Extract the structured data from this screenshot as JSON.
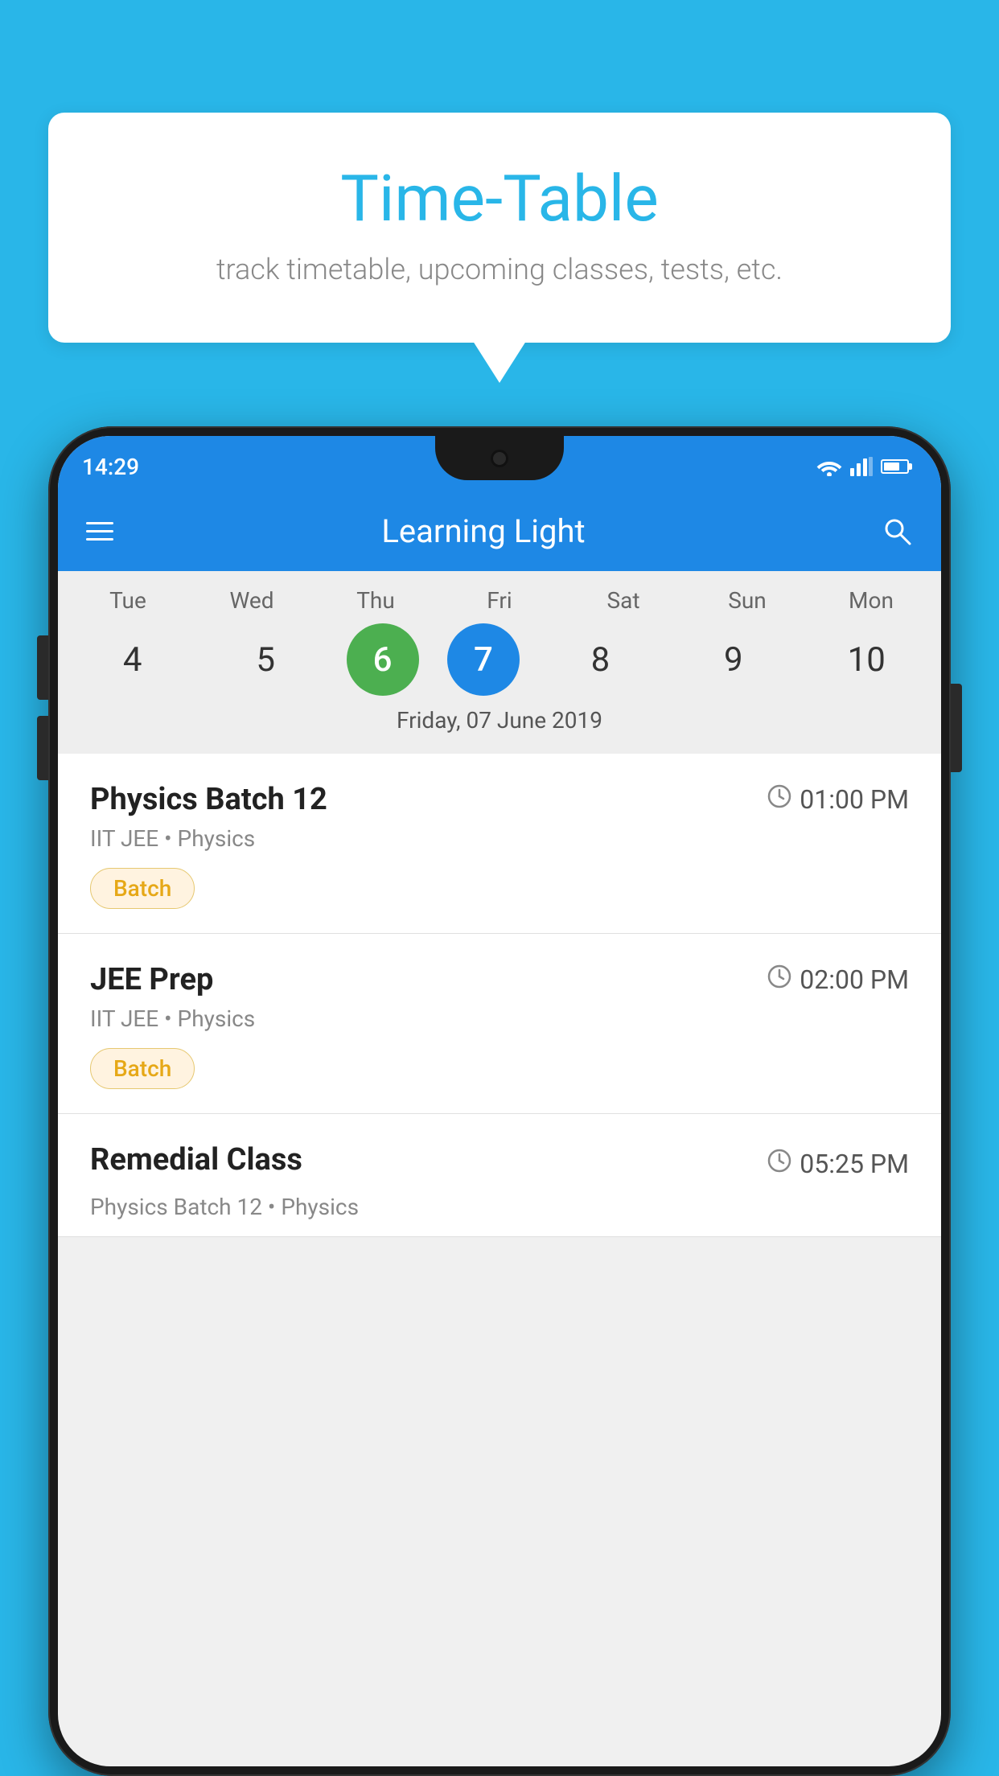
{
  "background_color": "#29B6E8",
  "speech_bubble": {
    "title": "Time-Table",
    "subtitle": "track timetable, upcoming classes, tests, etc."
  },
  "phone": {
    "status_bar": {
      "time": "14:29"
    },
    "app_bar": {
      "title": "Learning Light",
      "menu_icon": "hamburger-icon",
      "search_icon": "search-icon"
    },
    "calendar": {
      "days": [
        "Tue",
        "Wed",
        "Thu",
        "Fri",
        "Sat",
        "Sun",
        "Mon"
      ],
      "dates": [
        "4",
        "5",
        "6",
        "7",
        "8",
        "9",
        "10"
      ],
      "today_index": 2,
      "selected_index": 3,
      "selected_date_label": "Friday, 07 June 2019"
    },
    "schedule_items": [
      {
        "title": "Physics Batch 12",
        "time": "01:00 PM",
        "subtitle": "IIT JEE • Physics",
        "badge": "Batch"
      },
      {
        "title": "JEE Prep",
        "time": "02:00 PM",
        "subtitle": "IIT JEE • Physics",
        "badge": "Batch"
      },
      {
        "title": "Remedial Class",
        "time": "05:25 PM",
        "subtitle": "Physics Batch 12 • Physics",
        "badge": null
      }
    ]
  }
}
